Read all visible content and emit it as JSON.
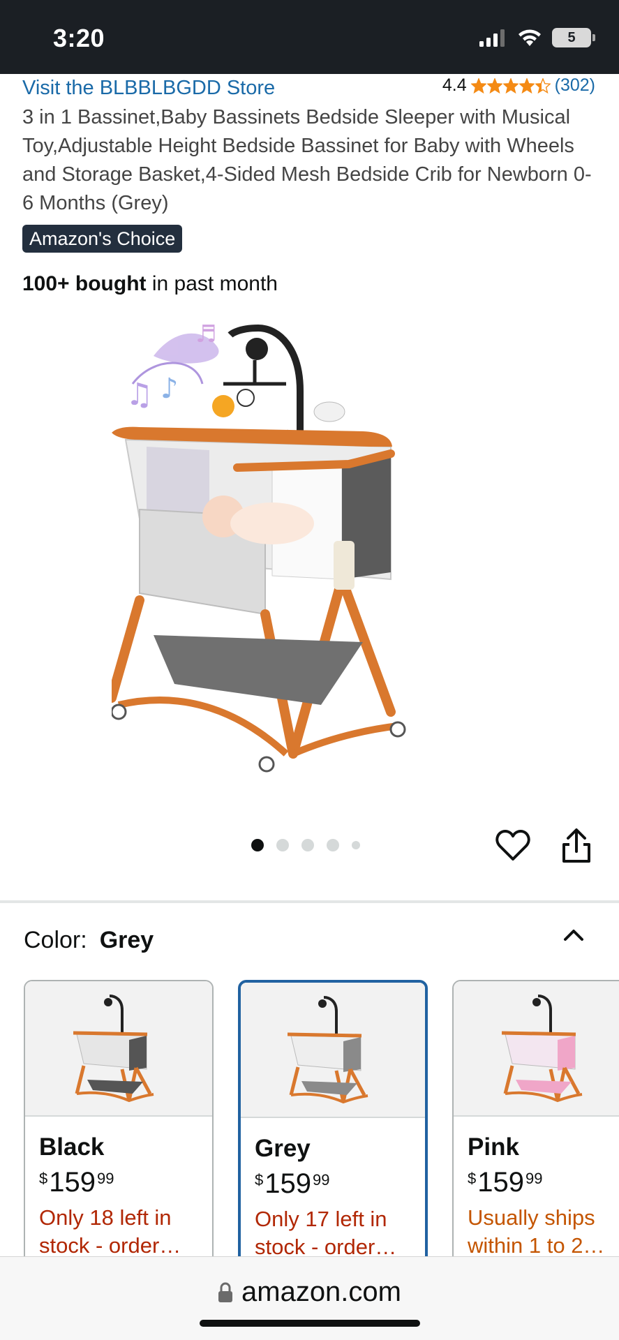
{
  "status_bar": {
    "time": "3:20",
    "battery_level": "5"
  },
  "header": {
    "store_link": "Visit the BLBBLBGDD Store",
    "rating_value": "4.4",
    "rating_stars": 4.4,
    "rating_count": "(302)",
    "star_color": "#f48a14"
  },
  "product": {
    "title": "3 in 1 Bassinet,Baby Bassinets Bedside Sleeper with Musical Toy,Adjustable Height Bedside Bassinet for Baby with Wheels and Storage Basket,4-Sided Mesh Bedside Crib for Newborn 0-6 Months (Grey)",
    "badge": "Amazon's Choice",
    "bought_bold": "100+ bought",
    "bought_rest": " in past month",
    "image_count": 5,
    "active_image": 1
  },
  "color_selector": {
    "label": "Color:",
    "value": "Grey",
    "options": [
      {
        "name": "Black",
        "currency": "$",
        "dollars": "159",
        "cents": "99",
        "stock": "Only 18 left in stock - order…",
        "selected": false
      },
      {
        "name": "Grey",
        "currency": "$",
        "dollars": "159",
        "cents": "99",
        "stock": "Only 17 left in stock - order…",
        "selected": true
      },
      {
        "name": "Pink",
        "currency": "$",
        "dollars": "159",
        "cents": "99",
        "stock": "Usually ships within 1 to 2…",
        "selected": false
      }
    ]
  },
  "browser": {
    "url": "amazon.com"
  },
  "colors": {
    "link": "#1a6aa8",
    "low_stock": "#b12704",
    "ships": "#c45500",
    "selected_border": "#2162a1",
    "badge_bg": "#232f3e"
  }
}
